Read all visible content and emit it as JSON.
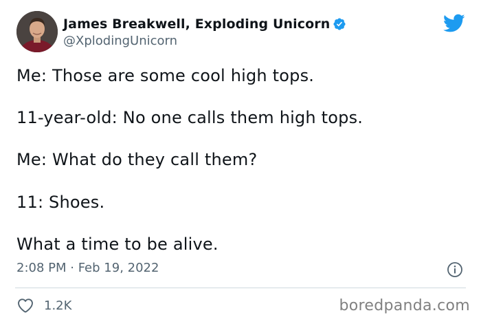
{
  "author": {
    "display_name": "James Breakwell, Exploding Unicorn",
    "handle": "@XplodingUnicorn",
    "avatar_icon": "user-avatar",
    "verified_icon": "verified-badge-icon"
  },
  "brand": {
    "icon": "twitter-bird-icon",
    "color": "#1d9bf0"
  },
  "tweet": {
    "lines": [
      "Me: Those are some cool high tops.",
      "11-year-old: No one calls them high tops.",
      "Me: What do they call them?",
      "11: Shoes.",
      "What a time to be alive."
    ],
    "timestamp": "2:08 PM · Feb 19, 2022"
  },
  "actions": {
    "like_icon": "heart-icon",
    "like_count": "1.2K",
    "info_icon": "info-icon"
  },
  "watermark": "boredpanda.com"
}
